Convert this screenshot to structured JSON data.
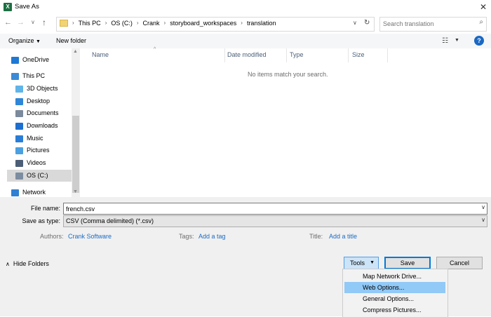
{
  "window": {
    "title": "Save As",
    "app_icon_letter": "X"
  },
  "address": {
    "crumbs": [
      "This PC",
      "OS (C:)",
      "Crank",
      "storyboard_workspaces",
      "translation"
    ]
  },
  "search": {
    "placeholder": "Search translation"
  },
  "toolbar": {
    "organize_label": "Organize",
    "new_folder_label": "New folder",
    "help_label": "?"
  },
  "nav": {
    "items": [
      {
        "label": "OneDrive",
        "icon": "cloud-icon",
        "color": "#1e78d4"
      },
      {
        "label": "This PC",
        "icon": "computer-icon",
        "color": "#3a8ad6"
      },
      {
        "label": "3D Objects",
        "icon": "cube-icon",
        "color": "#5fb4e8"
      },
      {
        "label": "Desktop",
        "icon": "desktop-icon",
        "color": "#2e86d8"
      },
      {
        "label": "Documents",
        "icon": "document-icon",
        "color": "#7b8a9c"
      },
      {
        "label": "Downloads",
        "icon": "download-icon",
        "color": "#1e6fd0"
      },
      {
        "label": "Music",
        "icon": "music-icon",
        "color": "#2a7dd6"
      },
      {
        "label": "Pictures",
        "icon": "pictures-icon",
        "color": "#4aa0e0"
      },
      {
        "label": "Videos",
        "icon": "video-icon",
        "color": "#4c5e77"
      },
      {
        "label": "OS (C:)",
        "icon": "drive-icon",
        "color": "#7d8da1"
      },
      {
        "label": "Network",
        "icon": "network-icon",
        "color": "#2f7fd2"
      }
    ]
  },
  "file_list": {
    "columns": [
      "Name",
      "Date modified",
      "Type",
      "Size"
    ],
    "empty_message": "No items match your search."
  },
  "form": {
    "filename_label": "File name:",
    "filename_value": "french.csv",
    "savetype_label": "Save as type:",
    "savetype_value": "CSV (Comma delimited) (*.csv)",
    "authors_label": "Authors:",
    "authors_value": "Crank Software",
    "tags_label": "Tags:",
    "tags_value": "Add a tag",
    "title_label": "Title:",
    "title_value": "Add a title"
  },
  "buttons": {
    "hide_folders": "Hide Folders",
    "tools": "Tools",
    "save": "Save",
    "cancel": "Cancel"
  },
  "tools_menu": {
    "items": [
      "Map Network Drive...",
      "Web Options...",
      "General Options...",
      "Compress Pictures..."
    ],
    "highlighted": "Web Options..."
  },
  "colors": {
    "accent": "#0078d7",
    "link": "#1a6bc4",
    "menu_highlight": "#91c9f7"
  }
}
